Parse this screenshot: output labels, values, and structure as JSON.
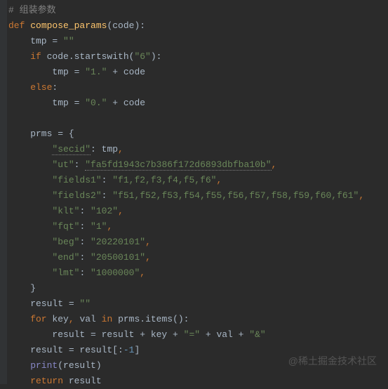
{
  "code": {
    "comment": "# 组装参数",
    "def_kw": "def ",
    "func_name": "compose_params",
    "lparen": "(",
    "param": "code",
    "rparen_colon": "):",
    "tmp_assign_pre": "    tmp = ",
    "empty_str": "\"\"",
    "if_kw": "    if ",
    "startswith_call_pre": "code.startswith(",
    "str_6": "\"6\"",
    "close_paren_colon": "):",
    "tmp_eq": "        tmp = ",
    "str_1dot": "\"1.\"",
    "plus_code": " + code",
    "else_kw": "    else",
    "colon": ":",
    "str_0dot": "\"0.\"",
    "prms_open": "    prms = {",
    "k_secid": "\"secid\"",
    "col_sp": ": ",
    "tmp_var": "tmp",
    "comma": ",",
    "k_ut": "\"ut\"",
    "v_ut": "\"fa5fd1943c7b386f172d6893dbfba10b\"",
    "k_fields1": "\"fields1\"",
    "v_fields1": "\"f1,f2,f3,f4,f5,f6\"",
    "k_fields2": "\"fields2\"",
    "v_fields2": "\"f51,f52,f53,f54,f55,f56,f57,f58,f59,f60,f61\"",
    "k_klt": "\"klt\"",
    "v_klt": "\"102\"",
    "k_fqt": "\"fqt\"",
    "v_fqt": "\"1\"",
    "k_beg": "\"beg\"",
    "v_beg": "\"20220101\"",
    "k_end": "\"end\"",
    "v_end": "\"20500101\"",
    "k_lmt": "\"lmt\"",
    "v_lmt": "\"1000000\"",
    "brace_close": "    }",
    "result_init": "    result = ",
    "for_kw": "    for ",
    "key_var": "key",
    "comma_sp": ", ",
    "val_var": "val",
    "in_kw": " in ",
    "prms_items": "prms.items():",
    "result_concat_pre": "        result = result + key + ",
    "str_eq": "\"=\"",
    "plus_val_plus": " + val + ",
    "str_amp": "\"&\"",
    "slice_line": "    result = result[:",
    "neg1": "-1",
    "bracket_close": "]",
    "print_kw": "    print",
    "print_arg": "(result)",
    "return_kw": "    return ",
    "result_var": "result",
    "indent8": "        "
  },
  "watermark": "@稀土掘金技术社区"
}
